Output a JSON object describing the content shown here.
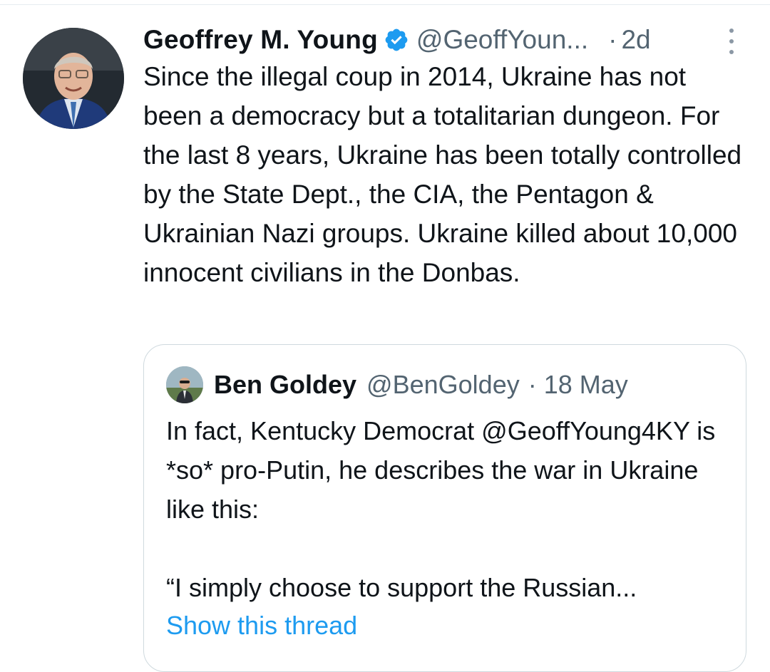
{
  "tweet": {
    "author_name": "Geoffrey M. Young",
    "handle": "@GeoffYoun...",
    "separator": "·",
    "time": "2d",
    "text": "Since the illegal coup in 2014, Ukraine has not been a democracy but a totalitarian dungeon. For the last 8 years, Ukraine has been totally controlled by the State Dept., the CIA, the Pentagon & Ukrainian Nazi groups. Ukraine killed about 10,000 innocent civilians in the Donbas.",
    "verified": true,
    "avatar_icon": "profile-photo",
    "more_icon": "more-vertical-icon"
  },
  "quote": {
    "author_name": "Ben Goldey",
    "handle": "@BenGoldey",
    "separator": "·",
    "time": "18 May",
    "text": "In fact, Kentucky Democrat @GeoffYoung4KY is *so* pro-Putin, he describes the war in Ukraine like this:\n\n“I simply choose to support the Russian...",
    "show_thread_label": "Show this thread"
  },
  "colors": {
    "text_primary": "#0f1419",
    "text_secondary": "#536471",
    "link": "#1d9bf0",
    "verified": "#1d9bf0",
    "border": "#cfd9de"
  }
}
